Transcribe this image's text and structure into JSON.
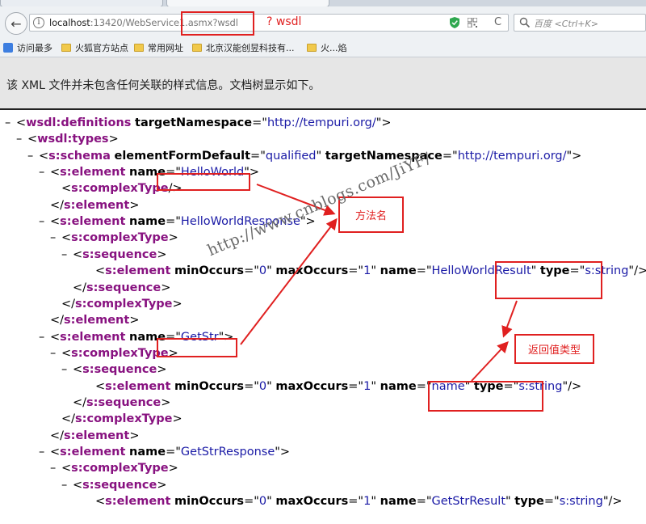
{
  "browser": {
    "url_host": "localhost",
    "url_rest": ":13420/WebService1.asmx?wsdl",
    "search_placeholder": "百度 <Ctrl+K>",
    "reload_glyph": "C"
  },
  "bookmarks": [
    {
      "label": "访问最多",
      "icon": "bookmark-icon"
    },
    {
      "label": "火狐官方站点",
      "icon": "folder-icon"
    },
    {
      "label": "常用网址",
      "icon": "folder-icon"
    },
    {
      "label": "北京汉能创昱科技有...",
      "icon": "folder-icon"
    },
    {
      "label": "火...焰",
      "icon": "folder-icon"
    }
  ],
  "info_banner": "该 XML 文件并未包含任何关联的样式信息。文档树显示如下。",
  "annotations": {
    "query_note": "? wsdl",
    "method_name": "方法名",
    "return_type": "返回值类型",
    "watermark": "http://www.cnblogs.com/JiYF/"
  },
  "xml_lines": [
    {
      "marker": "–",
      "parts": [
        [
          "p",
          "<"
        ],
        [
          "t",
          "wsdl:definitions"
        ],
        [
          "w",
          " "
        ],
        [
          "a",
          "targetNamespace"
        ],
        [
          "p",
          "=\""
        ],
        [
          "v",
          "http://tempuri.org/"
        ],
        [
          "p",
          "\">"
        ]
      ]
    },
    {
      "marker": "–",
      "parts": [
        [
          "p",
          "<"
        ],
        [
          "t",
          "wsdl:types"
        ],
        [
          "p",
          ">"
        ]
      ]
    },
    {
      "marker": "–",
      "parts": [
        [
          "p",
          "<"
        ],
        [
          "t",
          "s:schema"
        ],
        [
          "w",
          " "
        ],
        [
          "a",
          "elementFormDefault"
        ],
        [
          "p",
          "=\""
        ],
        [
          "v",
          "qualified"
        ],
        [
          "p",
          "\""
        ],
        [
          "w",
          " "
        ],
        [
          "a",
          "targetNamespace"
        ],
        [
          "p",
          "=\""
        ],
        [
          "v",
          "http://tempuri.org/"
        ],
        [
          "p",
          "\">"
        ]
      ]
    },
    {
      "marker": "–",
      "parts": [
        [
          "p",
          "<"
        ],
        [
          "t",
          "s:element"
        ],
        [
          "w",
          " "
        ],
        [
          "a",
          "name"
        ],
        [
          "p",
          "=\""
        ],
        [
          "v",
          "HelloWorld"
        ],
        [
          "p",
          "\">"
        ]
      ]
    },
    {
      "marker": "",
      "parts": [
        [
          "p",
          "<"
        ],
        [
          "t",
          "s:complexType"
        ],
        [
          "p",
          "/>"
        ]
      ]
    },
    {
      "marker": "",
      "parts": [
        [
          "p",
          "</"
        ],
        [
          "t",
          "s:element"
        ],
        [
          "p",
          ">"
        ]
      ]
    },
    {
      "marker": "–",
      "parts": [
        [
          "p",
          "<"
        ],
        [
          "t",
          "s:element"
        ],
        [
          "w",
          " "
        ],
        [
          "a",
          "name"
        ],
        [
          "p",
          "=\""
        ],
        [
          "v",
          "HelloWorldResponse"
        ],
        [
          "p",
          "\">"
        ]
      ]
    },
    {
      "marker": "–",
      "parts": [
        [
          "p",
          "<"
        ],
        [
          "t",
          "s:complexType"
        ],
        [
          "p",
          ">"
        ]
      ]
    },
    {
      "marker": "–",
      "parts": [
        [
          "p",
          "<"
        ],
        [
          "t",
          "s:sequence"
        ],
        [
          "p",
          ">"
        ]
      ]
    },
    {
      "marker": "",
      "parts": [
        [
          "p",
          "<"
        ],
        [
          "t",
          "s:element"
        ],
        [
          "w",
          " "
        ],
        [
          "a",
          "minOccurs"
        ],
        [
          "p",
          "=\""
        ],
        [
          "v",
          "0"
        ],
        [
          "p",
          "\""
        ],
        [
          "w",
          " "
        ],
        [
          "a",
          "maxOccurs"
        ],
        [
          "p",
          "=\""
        ],
        [
          "v",
          "1"
        ],
        [
          "p",
          "\""
        ],
        [
          "w",
          " "
        ],
        [
          "a",
          "name"
        ],
        [
          "p",
          "=\""
        ],
        [
          "v",
          "HelloWorldResult"
        ],
        [
          "p",
          "\""
        ],
        [
          "w",
          " "
        ],
        [
          "a",
          "type"
        ],
        [
          "p",
          "=\""
        ],
        [
          "v",
          "s:string"
        ],
        [
          "p",
          "\"/>"
        ]
      ]
    },
    {
      "marker": "",
      "parts": [
        [
          "p",
          "</"
        ],
        [
          "t",
          "s:sequence"
        ],
        [
          "p",
          ">"
        ]
      ]
    },
    {
      "marker": "",
      "parts": [
        [
          "p",
          "</"
        ],
        [
          "t",
          "s:complexType"
        ],
        [
          "p",
          ">"
        ]
      ]
    },
    {
      "marker": "",
      "parts": [
        [
          "p",
          "</"
        ],
        [
          "t",
          "s:element"
        ],
        [
          "p",
          ">"
        ]
      ]
    },
    {
      "marker": "–",
      "parts": [
        [
          "p",
          "<"
        ],
        [
          "t",
          "s:element"
        ],
        [
          "w",
          " "
        ],
        [
          "a",
          "name"
        ],
        [
          "p",
          "=\""
        ],
        [
          "v",
          "GetStr"
        ],
        [
          "p",
          "\">"
        ]
      ]
    },
    {
      "marker": "–",
      "parts": [
        [
          "p",
          "<"
        ],
        [
          "t",
          "s:complexType"
        ],
        [
          "p",
          ">"
        ]
      ]
    },
    {
      "marker": "–",
      "parts": [
        [
          "p",
          "<"
        ],
        [
          "t",
          "s:sequence"
        ],
        [
          "p",
          ">"
        ]
      ]
    },
    {
      "marker": "",
      "parts": [
        [
          "p",
          "<"
        ],
        [
          "t",
          "s:element"
        ],
        [
          "w",
          " "
        ],
        [
          "a",
          "minOccurs"
        ],
        [
          "p",
          "=\""
        ],
        [
          "v",
          "0"
        ],
        [
          "p",
          "\""
        ],
        [
          "w",
          " "
        ],
        [
          "a",
          "maxOccurs"
        ],
        [
          "p",
          "=\""
        ],
        [
          "v",
          "1"
        ],
        [
          "p",
          "\""
        ],
        [
          "w",
          " "
        ],
        [
          "a",
          "name"
        ],
        [
          "p",
          "=\""
        ],
        [
          "v",
          "name"
        ],
        [
          "p",
          "\""
        ],
        [
          "w",
          " "
        ],
        [
          "a",
          "type"
        ],
        [
          "p",
          "=\""
        ],
        [
          "v",
          "s:string"
        ],
        [
          "p",
          "\"/>"
        ]
      ]
    },
    {
      "marker": "",
      "parts": [
        [
          "p",
          "</"
        ],
        [
          "t",
          "s:sequence"
        ],
        [
          "p",
          ">"
        ]
      ]
    },
    {
      "marker": "",
      "parts": [
        [
          "p",
          "</"
        ],
        [
          "t",
          "s:complexType"
        ],
        [
          "p",
          ">"
        ]
      ]
    },
    {
      "marker": "",
      "parts": [
        [
          "p",
          "</"
        ],
        [
          "t",
          "s:element"
        ],
        [
          "p",
          ">"
        ]
      ]
    },
    {
      "marker": "–",
      "parts": [
        [
          "p",
          "<"
        ],
        [
          "t",
          "s:element"
        ],
        [
          "w",
          " "
        ],
        [
          "a",
          "name"
        ],
        [
          "p",
          "=\""
        ],
        [
          "v",
          "GetStrResponse"
        ],
        [
          "p",
          "\">"
        ]
      ]
    },
    {
      "marker": "–",
      "parts": [
        [
          "p",
          "<"
        ],
        [
          "t",
          "s:complexType"
        ],
        [
          "p",
          ">"
        ]
      ]
    },
    {
      "marker": "–",
      "parts": [
        [
          "p",
          "<"
        ],
        [
          "t",
          "s:sequence"
        ],
        [
          "p",
          ">"
        ]
      ]
    },
    {
      "marker": "",
      "parts": [
        [
          "p",
          "<"
        ],
        [
          "t",
          "s:element"
        ],
        [
          "w",
          " "
        ],
        [
          "a",
          "minOccurs"
        ],
        [
          "p",
          "=\""
        ],
        [
          "v",
          "0"
        ],
        [
          "p",
          "\""
        ],
        [
          "w",
          " "
        ],
        [
          "a",
          "maxOccurs"
        ],
        [
          "p",
          "=\""
        ],
        [
          "v",
          "1"
        ],
        [
          "p",
          "\""
        ],
        [
          "w",
          " "
        ],
        [
          "a",
          "name"
        ],
        [
          "p",
          "=\""
        ],
        [
          "v",
          "GetStrResult"
        ],
        [
          "p",
          "\""
        ],
        [
          "w",
          " "
        ],
        [
          "a",
          "type"
        ],
        [
          "p",
          "=\""
        ],
        [
          "v",
          "s:string"
        ],
        [
          "p",
          "\"/>"
        ]
      ]
    }
  ],
  "colors": {
    "tag": "#881280",
    "attr_value": "#1a1aa6",
    "annotation": "#e02020"
  }
}
